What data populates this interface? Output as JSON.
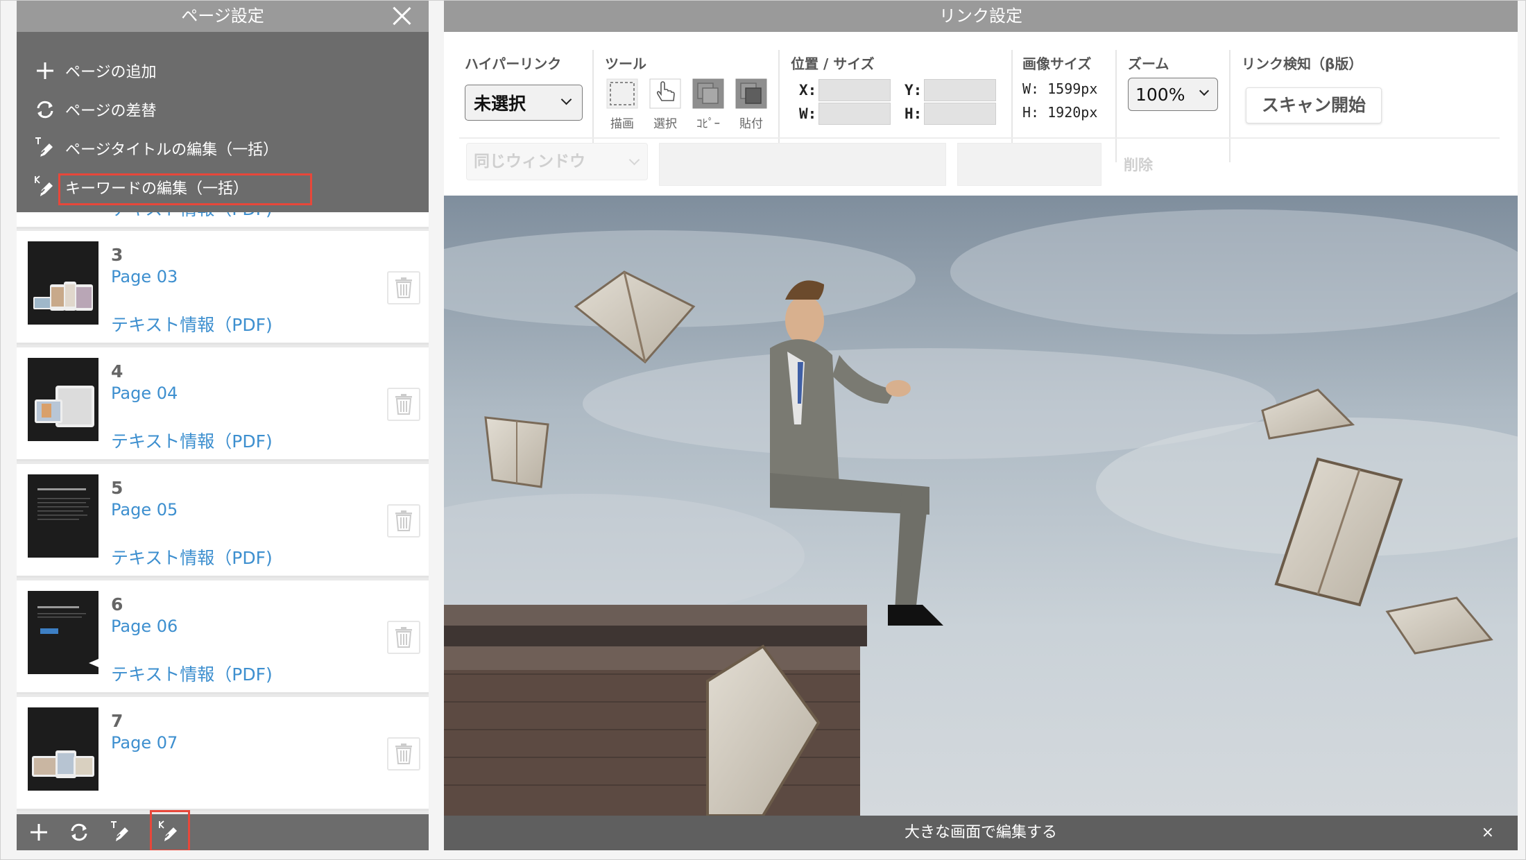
{
  "left_panel": {
    "title": "ページ設定",
    "menu": [
      {
        "label": "ページの追加",
        "icon": "plus-icon"
      },
      {
        "label": "ページの差替",
        "icon": "refresh-icon"
      },
      {
        "label": "ページタイトルの編集（一括）",
        "icon": "title-edit-icon"
      },
      {
        "label": "キーワードの編集（一括）",
        "icon": "keyword-edit-icon",
        "highlighted": true
      }
    ],
    "pages": [
      {
        "number": "",
        "title": "",
        "text_link": "テキスト情報（PDF)"
      },
      {
        "number": "3",
        "title": "Page 03",
        "text_link": "テキスト情報（PDF)"
      },
      {
        "number": "4",
        "title": "Page 04",
        "text_link": "テキスト情報（PDF)"
      },
      {
        "number": "5",
        "title": "Page 05",
        "text_link": "テキスト情報（PDF)"
      },
      {
        "number": "6",
        "title": "Page 06",
        "text_link": "テキスト情報（PDF)"
      },
      {
        "number": "7",
        "title": "Page 07",
        "text_link": ""
      }
    ],
    "toolbar_icons": [
      "plus-icon",
      "refresh-icon",
      "title-edit-icon",
      "keyword-edit-icon"
    ]
  },
  "right_panel": {
    "title": "リンク設定",
    "hyperlink": {
      "title": "ハイパーリンク",
      "value": "未選択"
    },
    "tools": {
      "title": "ツール",
      "items": [
        {
          "label": "描画",
          "icon": "draw-rect-icon"
        },
        {
          "label": "選択",
          "icon": "hand-pointer-icon"
        },
        {
          "label": "ｺﾋﾟｰ",
          "icon": "copy-icon"
        },
        {
          "label": "貼付",
          "icon": "paste-icon"
        }
      ]
    },
    "position_size": {
      "title": "位置 / サイズ",
      "x_label": "X:",
      "y_label": "Y:",
      "w_label": "W:",
      "h_label": "H:"
    },
    "image_size": {
      "title": "画像サイズ",
      "w": "W: 1599px",
      "h": "H: 1920px"
    },
    "zoom": {
      "title": "ズーム",
      "value": "100%"
    },
    "link_detect": {
      "title": "リンク検知（β版）",
      "button": "スキャン開始"
    },
    "target_window": "同じウィンドウ",
    "delete_label": "削除",
    "bottom_bar": "大きな画面で編集する",
    "bottom_close": "×"
  },
  "colors": {
    "highlight": "#e8473a",
    "link": "#3d8fcf",
    "panel_header": "#9a9a9a",
    "menu_bg": "#6c6c6c"
  }
}
